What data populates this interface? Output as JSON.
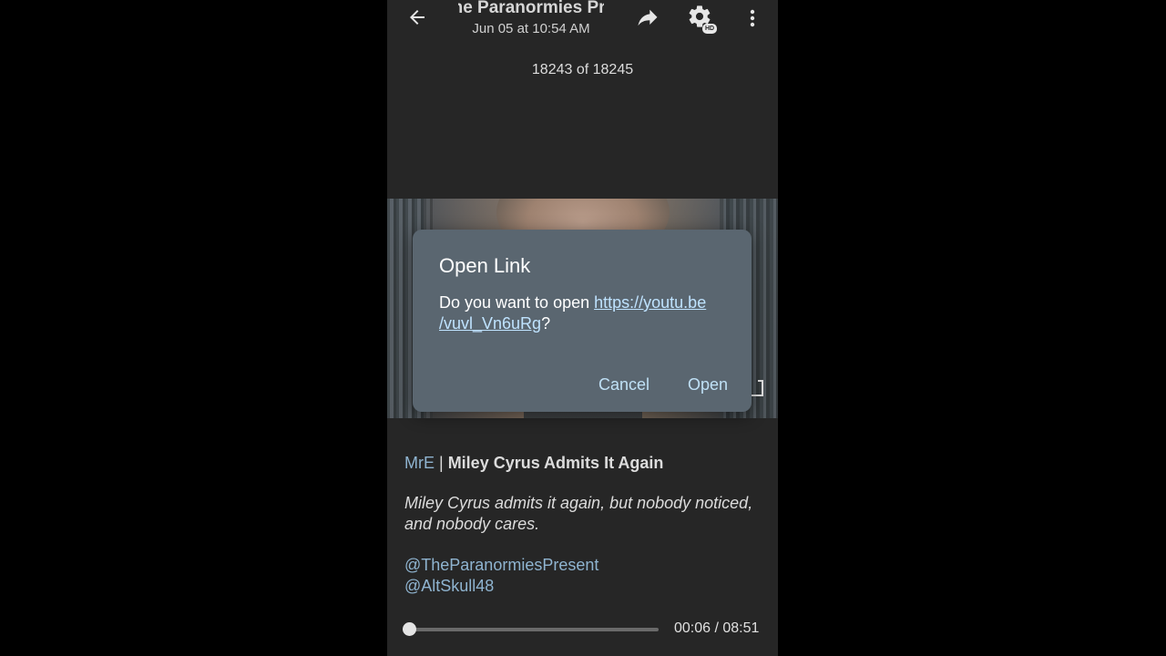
{
  "header": {
    "title": "The Paranormies Present",
    "subtitle": "Jun 05 at 10:54 AM",
    "hd_badge": "HD"
  },
  "counter": "18243 of 18245",
  "caption": {
    "author": "MrE",
    "separator": " | ",
    "title": "Miley Cyrus Admits It Again",
    "description": "Miley Cyrus admits it again, but nobody noticed, and nobody cares.",
    "mentions": [
      "@TheParanormiesPresent",
      "@AltSkull48"
    ]
  },
  "player": {
    "time": "00:06 / 08:51",
    "progress_fraction": 0.011
  },
  "dialog": {
    "title": "Open Link",
    "message_prefix": "Do you want to open ",
    "url_line1": "https://youtu.be",
    "url_line2": "/vuvl_Vn6uRg",
    "message_suffix": "?",
    "cancel_label": "Cancel",
    "open_label": "Open"
  },
  "icons": [
    "back-arrow-icon",
    "share-icon",
    "settings-gear-icon",
    "more-vertical-icon",
    "fullscreen-icon"
  ]
}
